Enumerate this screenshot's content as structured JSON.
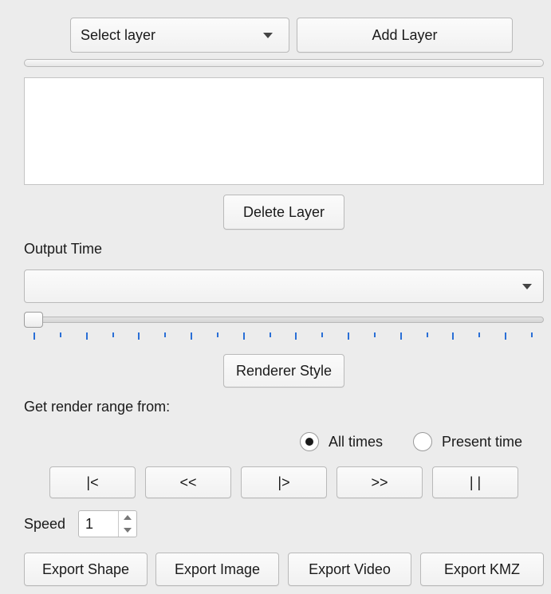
{
  "layer": {
    "select_value": "Select layer",
    "add_label": "Add Layer",
    "progress_fraction": 0,
    "delete_label": "Delete Layer"
  },
  "output_time": {
    "label": "Output Time",
    "combo_value": "",
    "slider_fraction": 0,
    "tick_count": 20
  },
  "renderer_style_label": "Renderer Style",
  "render_range": {
    "label": "Get render range from:",
    "options": [
      "All times",
      "Present time"
    ],
    "selected": "All times"
  },
  "playback": {
    "first_label": "|<",
    "back_label": "<<",
    "play_label": "|>",
    "forward_label": ">>",
    "pause_label": "| |"
  },
  "speed": {
    "label": "Speed",
    "value": "1"
  },
  "export": {
    "shape_label": "Export Shape",
    "image_label": "Export Image",
    "video_label": "Export Video",
    "kmz_label": "Export KMZ"
  },
  "colors": {
    "tick": "#2a6fd6",
    "background": "#ececec"
  }
}
